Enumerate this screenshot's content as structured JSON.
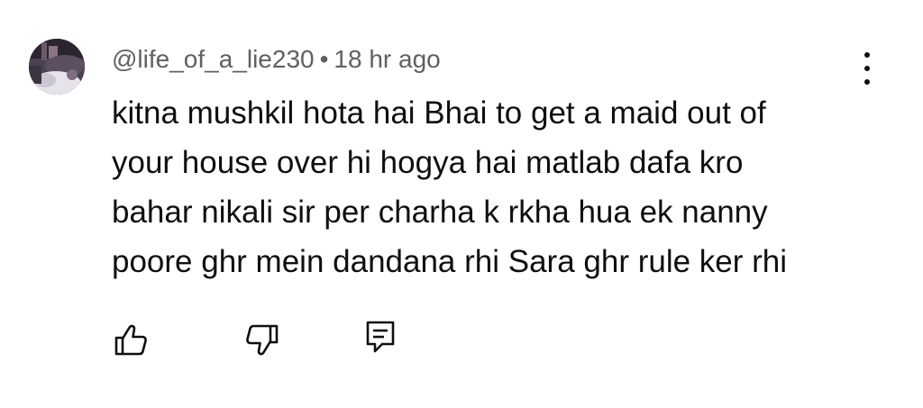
{
  "comment": {
    "author": "@life_of_a_lie230",
    "separator": "•",
    "timestamp": "18 hr ago",
    "text_lines": [
      "kitna mushkil hota hai Bhai to get a maid out of",
      "your house over hi hogya hai matlab dafa kro",
      "bahar nikali sir per charha k rkha hua ek nanny",
      "poore ghr mein dandana rhi Sara ghr rule ker rhi"
    ]
  },
  "icons": {
    "avatar": "avatar-image",
    "more": "more-vert-icon",
    "like": "thumbs-up-icon",
    "dislike": "thumbs-down-icon",
    "reply": "reply-comment-icon"
  },
  "colors": {
    "text": "#0f0f0f",
    "meta": "#606060",
    "background": "#ffffff"
  }
}
